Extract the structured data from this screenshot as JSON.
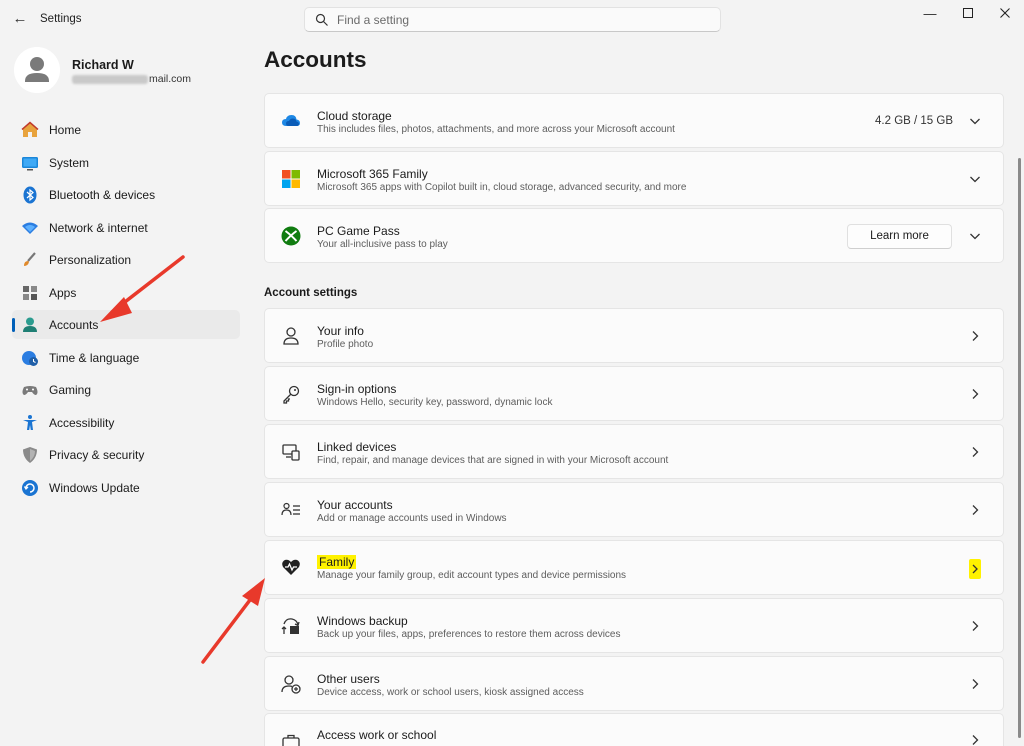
{
  "window": {
    "title": "Settings",
    "search_placeholder": "Find a setting"
  },
  "profile": {
    "name": "Richard W",
    "email_visible": "mail.com"
  },
  "sidebar": {
    "items": [
      {
        "label": "Home",
        "icon": "home-icon"
      },
      {
        "label": "System",
        "icon": "system-icon"
      },
      {
        "label": "Bluetooth & devices",
        "icon": "bluetooth-icon"
      },
      {
        "label": "Network & internet",
        "icon": "network-icon"
      },
      {
        "label": "Personalization",
        "icon": "brush-icon"
      },
      {
        "label": "Apps",
        "icon": "apps-icon"
      },
      {
        "label": "Accounts",
        "icon": "accounts-icon",
        "selected": true
      },
      {
        "label": "Time & language",
        "icon": "globe-clock-icon"
      },
      {
        "label": "Gaming",
        "icon": "gamepad-icon"
      },
      {
        "label": "Accessibility",
        "icon": "accessibility-icon"
      },
      {
        "label": "Privacy & security",
        "icon": "shield-icon"
      },
      {
        "label": "Windows Update",
        "icon": "update-icon"
      }
    ]
  },
  "main": {
    "title": "Accounts",
    "top_cards": [
      {
        "title": "Cloud storage",
        "subtitle": "This includes files, photos, attachments, and more across your Microsoft account",
        "value": "4.2 GB / 15 GB",
        "icon": "cloud-icon"
      },
      {
        "title": "Microsoft 365 Family",
        "subtitle": "Microsoft 365 apps with Copilot built in, cloud storage, advanced security, and more",
        "icon": "microsoft-logo-icon"
      },
      {
        "title": "PC Game Pass",
        "subtitle": "Your all-inclusive pass to play",
        "button": "Learn more",
        "icon": "xbox-icon"
      }
    ],
    "section_label": "Account settings",
    "settings": [
      {
        "title": "Your info",
        "subtitle": "Profile photo",
        "icon": "person-icon"
      },
      {
        "title": "Sign-in options",
        "subtitle": "Windows Hello, security key, password, dynamic lock",
        "icon": "key-icon"
      },
      {
        "title": "Linked devices",
        "subtitle": "Find, repair, and manage devices that are signed in with your Microsoft account",
        "icon": "devices-icon"
      },
      {
        "title": "Your accounts",
        "subtitle": "Add or manage accounts used in Windows",
        "icon": "people-list-icon"
      },
      {
        "title": "Family",
        "subtitle": "Manage your family group, edit account types and device permissions",
        "icon": "family-heart-icon",
        "highlighted": true
      },
      {
        "title": "Windows backup",
        "subtitle": "Back up your files, apps, preferences to restore them across devices",
        "icon": "backup-icon"
      },
      {
        "title": "Other users",
        "subtitle": "Device access, work or school users, kiosk assigned access",
        "icon": "add-person-icon"
      },
      {
        "title": "Access work or school",
        "subtitle": "",
        "icon": "briefcase-icon"
      }
    ]
  },
  "colors": {
    "accent": "#005fb8",
    "highlight": "#fff200",
    "annotation_arrow": "#e8392b"
  }
}
